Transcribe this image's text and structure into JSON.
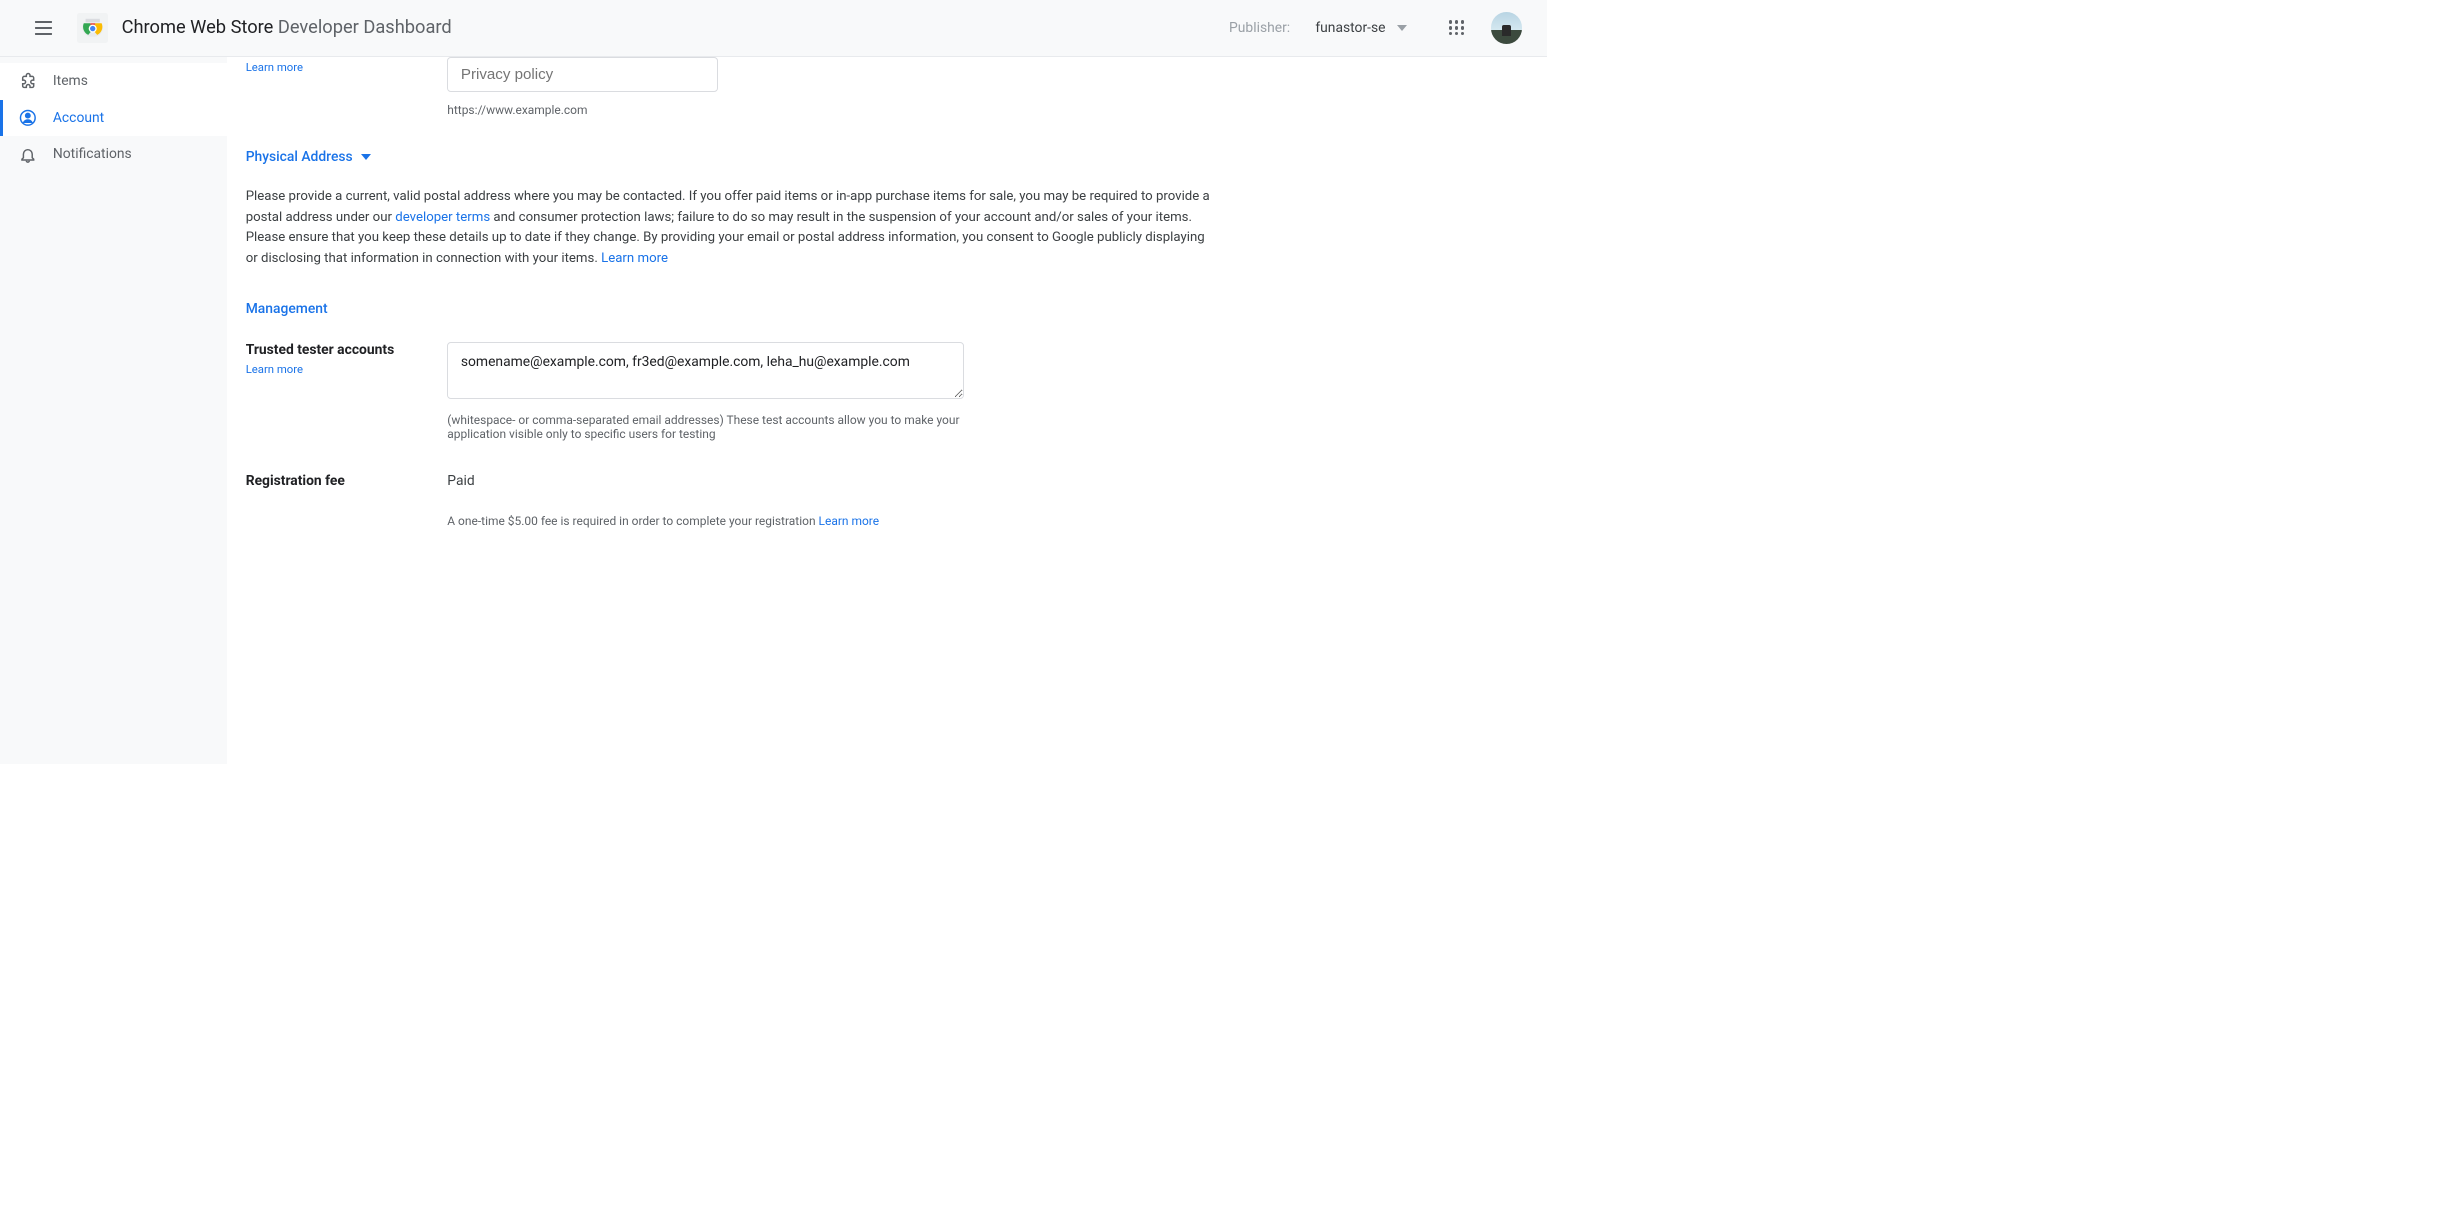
{
  "header": {
    "title_strong": "Chrome Web Store",
    "title_rest": "Developer Dashboard",
    "publisher_label": "Publisher:",
    "publisher_value": "funastor-se"
  },
  "sidebar": {
    "items": "Items",
    "account": "Account",
    "notifications": "Notifications"
  },
  "privacy": {
    "learn_more": "Learn more",
    "placeholder": "Privacy policy",
    "helper": "https://www.example.com"
  },
  "physical": {
    "header": "Physical Address",
    "para_pre": "Please provide a current, valid postal address where you may be contacted. If you offer paid items or in-app purchase items for sale, you may be required to provide a postal address under our ",
    "dev_terms": "developer terms",
    "para_mid": " and consumer protection laws; failure to do so may result in the suspension of your account and/or sales of your items. Please ensure that you keep these details up to date if they change. By providing your email or postal address information, you consent to Google publicly displaying or disclosing that information in connection with your items. ",
    "learn_more": "Learn more"
  },
  "management": {
    "title": "Management",
    "trusted_label": "Trusted tester accounts",
    "learn_more": "Learn more",
    "trusted_value": "somename@example.com, fr3ed@example.com, leha_hu@example.com",
    "trusted_helper": "(whitespace- or comma-separated email addresses) These test accounts allow you to make your application visible only to specific users for testing",
    "reg_label": "Registration fee",
    "reg_value": "Paid",
    "reg_helper_pre": "A one-time $5.00 fee is required in order to complete your registration ",
    "reg_learn": "Learn more"
  }
}
